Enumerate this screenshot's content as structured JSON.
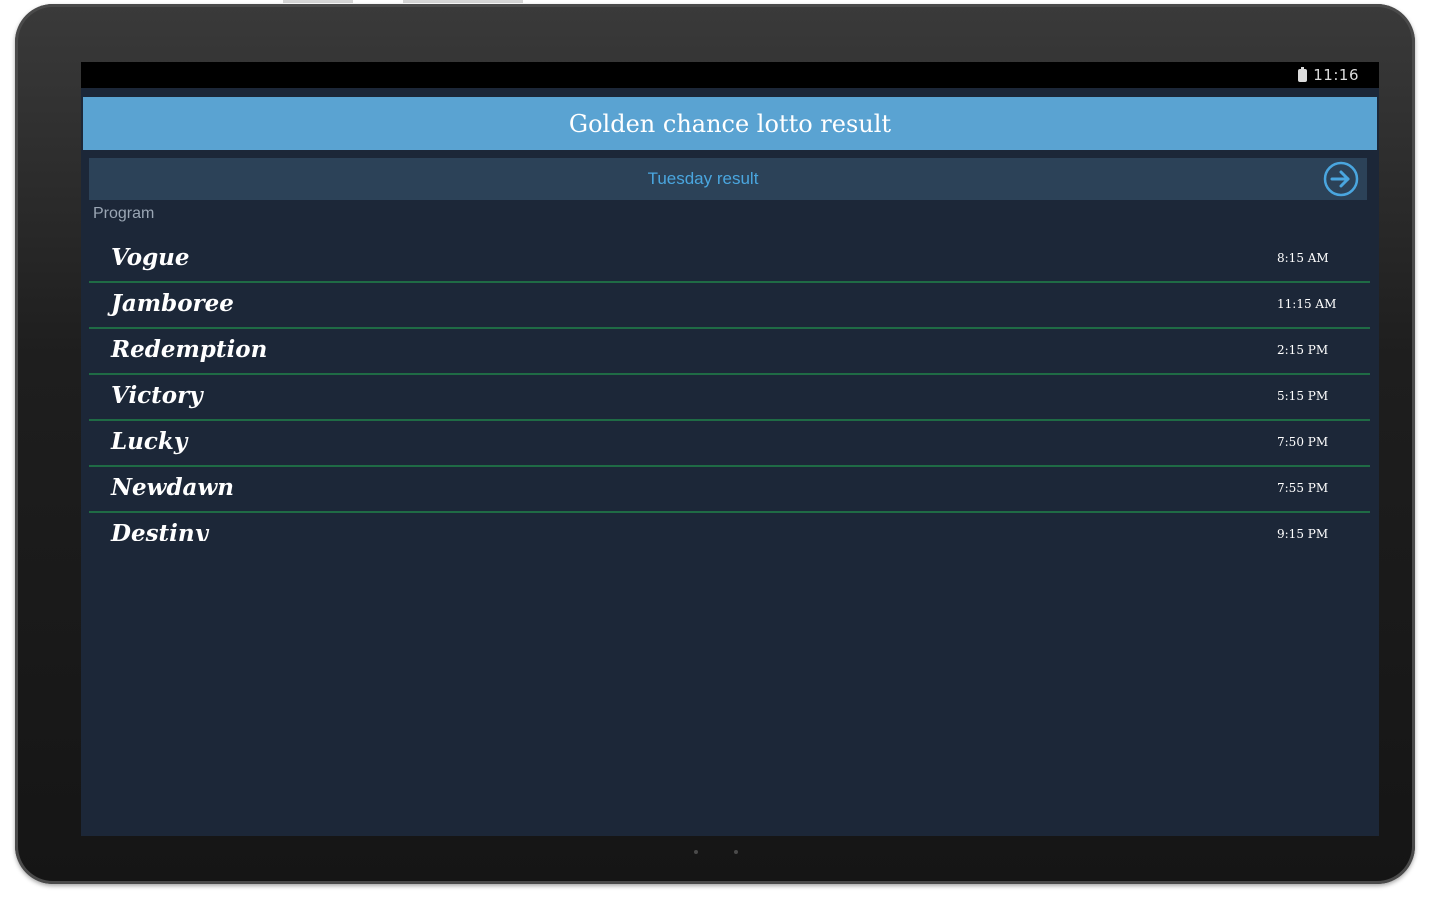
{
  "status_bar": {
    "time": "11:16",
    "battery_icon": "battery-icon"
  },
  "app": {
    "title": "Golden chance lotto result"
  },
  "day_bar": {
    "label": "Tuesday result",
    "next_icon": "arrow-right-circle-icon"
  },
  "section": {
    "label": "Program"
  },
  "programs": [
    {
      "name": "Vogue",
      "time": "8:15 AM"
    },
    {
      "name": "Jamboree",
      "time": "11:15 AM"
    },
    {
      "name": "Redemption",
      "time": "2:15 PM"
    },
    {
      "name": "Victory",
      "time": "5:15 PM"
    },
    {
      "name": "Lucky",
      "time": "7:50 PM"
    },
    {
      "name": "Newdawn",
      "time": "7:55 PM"
    },
    {
      "name": "Destiny",
      "time": "9:15 PM"
    }
  ],
  "colors": {
    "action_bar": "#5aa3d2",
    "screen_bg": "#1c2738",
    "day_bar_bg": "#2c4258",
    "accent_text": "#4aa6df",
    "row_divider": "#1f6b45"
  }
}
